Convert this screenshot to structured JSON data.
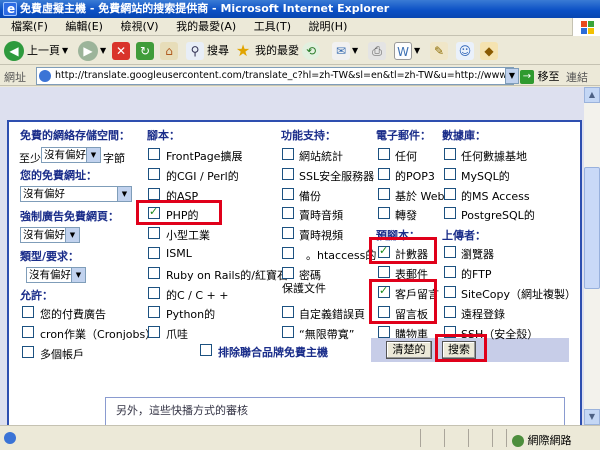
{
  "window": {
    "title": "免費虛擬主機 - 免費網站的搜索提供商 - Microsoft Internet Explorer"
  },
  "menu": [
    "檔案(F)",
    "編輯(E)",
    "檢視(V)",
    "我的最愛(A)",
    "工具(T)",
    "說明(H)"
  ],
  "toolbar": {
    "back_label": "上一頁",
    "search_label": "搜尋",
    "favorites_label": "我的最愛"
  },
  "address": {
    "label": "網址",
    "url": "http://translate.googleusercontent.com/translate_c?hl=zh-TW&sl=en&tl=zh-TW&u=http://www.free-webhosts.com/power-search",
    "go_label": "移至",
    "links_label": "連結"
  },
  "form": {
    "col1": {
      "storage_header": "免費的網絡存儲空間：",
      "storage_prefix": "至少",
      "storage_select": "沒有偏好",
      "storage_suffix": "字節",
      "domain_header": "您的免費網址：",
      "domain_select": "沒有偏好",
      "ads_header": "強制廣告免費網頁：",
      "ads_select": "沒有偏好",
      "type_header": "類型/要求：",
      "type_select": "沒有偏好",
      "allow_header": "允許：",
      "allow_items": [
        "您的付費廣告",
        "cron作業（Cronjobs）",
        "多個帳戶"
      ]
    },
    "col2": {
      "header": "腳本：",
      "items": [
        {
          "label": "FrontPage擴展",
          "checked": false
        },
        {
          "label": "的CGI / Perl的",
          "checked": false
        },
        {
          "label": "的ASP",
          "checked": false
        },
        {
          "label": "PHP的",
          "checked": true
        },
        {
          "label": "小型工業",
          "checked": false
        },
        {
          "label": "ISML",
          "checked": false
        },
        {
          "label": "Ruby on Rails的/紅寶石",
          "checked": false
        },
        {
          "label": "的C / C + +",
          "checked": false
        },
        {
          "label": "Python的",
          "checked": false
        },
        {
          "label": "爪哇",
          "checked": false
        }
      ]
    },
    "col3": {
      "header": "功能支持：",
      "items": [
        {
          "label": "網站統計"
        },
        {
          "label": "SSL安全服務器"
        },
        {
          "label": "備份"
        },
        {
          "label": "賣時音頻"
        },
        {
          "label": "賣時視頻"
        },
        {
          "label": "。htaccess的"
        },
        {
          "label": "密碼"
        },
        {
          "label": "保護文件"
        },
        {
          "label": "自定義錯誤頁"
        },
        {
          "label": "“無限帶寬”"
        }
      ],
      "exclude_label": "排除聯合品牌免費主機"
    },
    "col4": {
      "email_header": "電子郵件：",
      "email_items": [
        "任何",
        "的POP3",
        "基於 Web",
        "轉發"
      ],
      "prescripts_header": "預腳本：",
      "prescripts_items": [
        {
          "label": "計數器",
          "checked": true
        },
        {
          "label": "表郵件",
          "checked": false
        },
        {
          "label": "客戶留言",
          "checked": true
        },
        {
          "label": "留言板",
          "checked": false
        },
        {
          "label": "購物車",
          "checked": false
        }
      ],
      "clear_button": "清楚的"
    },
    "col5": {
      "db_header": "數據庫：",
      "db_items": [
        "任何數據基地",
        "MySQL的",
        "的MS Access",
        "PostgreSQL的"
      ],
      "upload_header": "上傳者：",
      "upload_items": [
        "瀏覽器",
        "的FTP",
        "SiteCopy（網址複製）",
        "遠程登錄",
        "SSH（安全殼）"
      ],
      "search_button": "搜索"
    },
    "bottom_text": "另外，這些快播方式的審核"
  },
  "status": {
    "zone": "網際網路"
  }
}
